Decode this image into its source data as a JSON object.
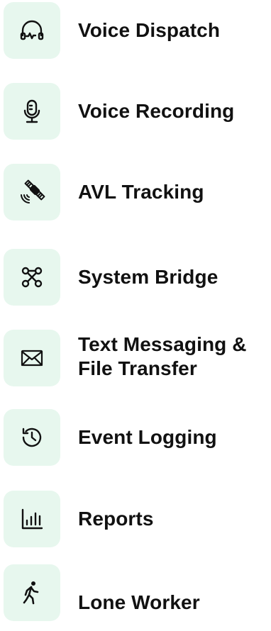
{
  "features": [
    {
      "label": "Voice Dispatch",
      "icon": "headset-icon"
    },
    {
      "label": "Voice Recording",
      "icon": "microphone-icon"
    },
    {
      "label": "AVL Tracking",
      "icon": "satellite-icon"
    },
    {
      "label": "System Bridge",
      "icon": "network-bridge-icon"
    },
    {
      "label": "Text Messaging & File Transfer",
      "icon": "envelope-icon"
    },
    {
      "label": "Event Logging",
      "icon": "history-clock-icon"
    },
    {
      "label": "Reports",
      "icon": "bar-chart-icon"
    },
    {
      "label": "Lone Worker",
      "icon": "walking-person-icon"
    }
  ],
  "colors": {
    "tile_background": "#e7f7ee",
    "icon_stroke": "#111111",
    "text": "#111111"
  }
}
